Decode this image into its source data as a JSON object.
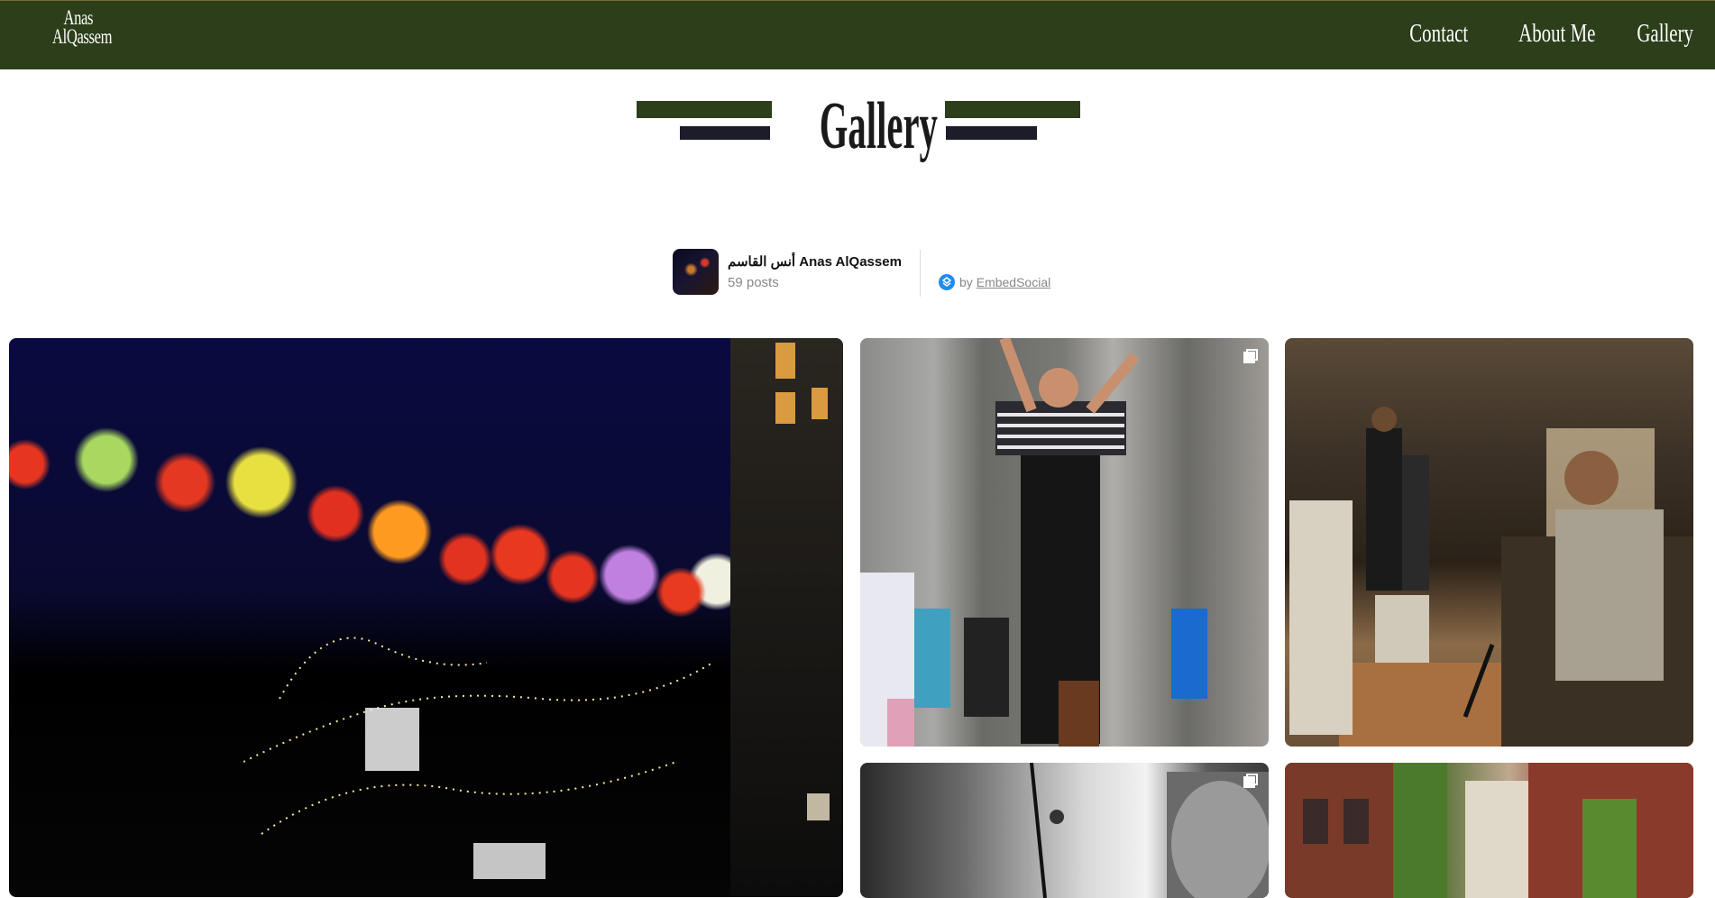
{
  "header": {
    "logo_line1": "Anas",
    "logo_line2": "AlQassem",
    "nav": [
      "Contact",
      "About Me",
      "Gallery"
    ]
  },
  "page_title": "Gallery",
  "profile": {
    "name": "أنس القاسم Anas AlQassem",
    "posts": "59 posts",
    "by_label": "by",
    "by_link": "EmbedSocial",
    "icon": "embedsocial-icon"
  },
  "gallery": {
    "tiles": [
      {
        "subject": "lanterns-night",
        "multi": false
      },
      {
        "subject": "street-performer",
        "multi": true
      },
      {
        "subject": "street-musician",
        "multi": false
      },
      {
        "subject": "bw-portrait",
        "multi": true
      },
      {
        "subject": "brick-alley",
        "multi": false
      }
    ]
  },
  "colors": {
    "header_bg": "#2c3e1a",
    "title_bar_green": "#2c3e1a",
    "title_bar_dark": "#1c1c2a",
    "accent_blue": "#1e8cf0"
  }
}
